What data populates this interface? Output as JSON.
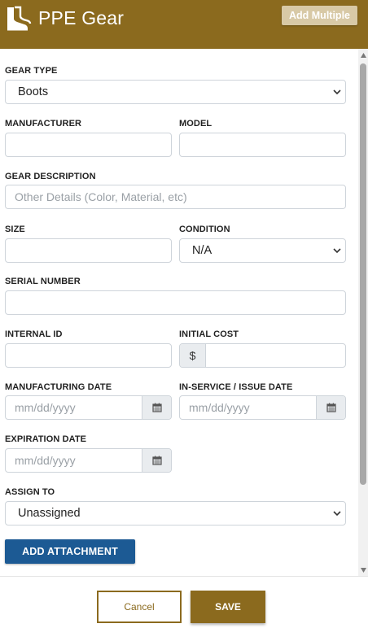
{
  "header": {
    "title": "PPE Gear",
    "add_multiple_label": "Add Multiple",
    "icon": "boots-icon",
    "brand_color": "#8b6a1e"
  },
  "form": {
    "gear_type": {
      "label": "GEAR TYPE",
      "value": "Boots"
    },
    "manufacturer": {
      "label": "MANUFACTURER",
      "value": ""
    },
    "model": {
      "label": "MODEL",
      "value": ""
    },
    "gear_description": {
      "label": "GEAR DESCRIPTION",
      "placeholder": "Other Details (Color, Material, etc)"
    },
    "size": {
      "label": "SIZE",
      "value": ""
    },
    "condition": {
      "label": "CONDITION",
      "value": "N/A"
    },
    "serial_number": {
      "label": "SERIAL NUMBER",
      "value": ""
    },
    "internal_id": {
      "label": "INTERNAL ID",
      "value": ""
    },
    "initial_cost": {
      "label": "INITIAL COST",
      "prefix": "$",
      "value": ""
    },
    "manufacturing_date": {
      "label": "MANUFACTURING DATE",
      "placeholder": "mm/dd/yyyy",
      "icon": "calendar-icon"
    },
    "in_service_date": {
      "label": "IN-SERVICE / ISSUE DATE",
      "placeholder": "mm/dd/yyyy",
      "icon": "calendar-icon"
    },
    "expiration_date": {
      "label": "EXPIRATION DATE",
      "placeholder": "mm/dd/yyyy",
      "icon": "calendar-icon"
    },
    "assign_to": {
      "label": "ASSIGN TO",
      "value": "Unassigned"
    },
    "add_attachment_label": "ADD ATTACHMENT",
    "attachment_color": "#1c5a94"
  },
  "footer": {
    "cancel_label": "Cancel",
    "save_label": "SAVE"
  }
}
